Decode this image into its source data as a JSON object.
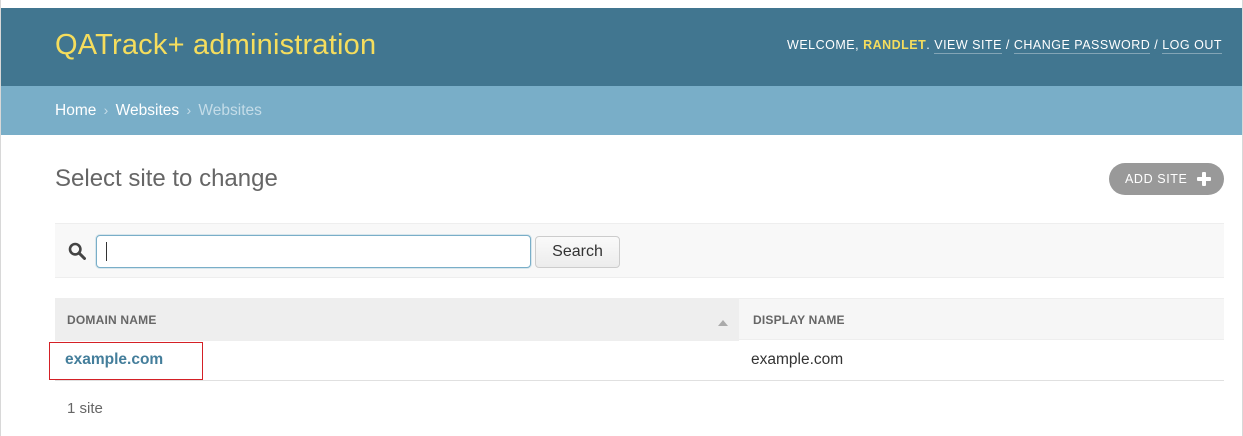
{
  "header": {
    "branding": "QATrack+ administration",
    "welcome": "WELCOME, ",
    "username": "RANDLET",
    "period": ". ",
    "view_site": "VIEW SITE",
    "change_password": "CHANGE PASSWORD",
    "log_out": "LOG OUT",
    "separator": " / "
  },
  "breadcrumbs": {
    "home": "Home",
    "app": "Websites",
    "current": "Websites",
    "arrow": "›"
  },
  "content": {
    "title": "Select site to change",
    "add_label": "ADD SITE"
  },
  "search": {
    "value": "",
    "button_label": "Search"
  },
  "table": {
    "columns": [
      "DOMAIN NAME",
      "DISPLAY NAME"
    ],
    "rows": [
      {
        "domain_name": "example.com",
        "display_name": "example.com"
      }
    ]
  },
  "paginator": {
    "text": "1 site"
  },
  "colors": {
    "header_bg": "#417690",
    "breadcrumbs_bg": "#79aec8",
    "branding": "#f5dd5d",
    "link": "#447e9b",
    "highlight": "#d42026"
  },
  "icons": {
    "search": "search-icon",
    "sort": "sort-ascending-icon",
    "add": "plus-icon"
  }
}
